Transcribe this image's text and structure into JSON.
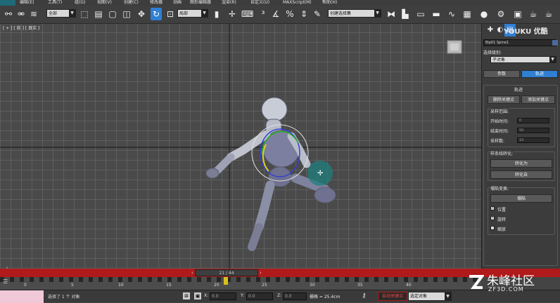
{
  "menu": [
    "编辑(E)",
    "工具(T)",
    "组(G)",
    "视图(V)",
    "创建(C)",
    "修改器",
    "动画",
    "图形编辑器",
    "渲染(R)",
    "自定义(U)",
    "MAXScript(M)",
    "帮助(H)"
  ],
  "toolbar": {
    "filter_value": "全部",
    "refcoord_value": "局部",
    "selection_set_value": "创建选择集",
    "icons": [
      "link-icon",
      "unlink-icon",
      "bind-icon",
      "select-icon",
      "select-by-name-icon",
      "rect-select-icon",
      "window-crossing-icon",
      "move-icon",
      "rotate-icon",
      "scale-icon",
      "pivot-icon",
      "snap-icon",
      "angle-snap-icon",
      "percent-snap-icon",
      "spinner-snap-icon",
      "mirror-icon",
      "align-icon",
      "layer-icon",
      "curve-editor-icon",
      "schematic-icon",
      "material-icon",
      "render-setup-icon",
      "render-frame-icon",
      "render-icon"
    ]
  },
  "viewport": {
    "label": "[ + ] [ 前 ] [ 真实 ]"
  },
  "watermark_logo": "YOUKU 优酷",
  "command_panel": {
    "object_name": "Bip01 Spine1",
    "selection_level_label": "选择级别:",
    "sub_object_label": "子对象",
    "tab_params": "参数",
    "tab_trajectories": "轨迹",
    "rollout_title": "轨迹",
    "delete_key_btn": "删除关键点",
    "add_key_btn": "添加关键点",
    "sample_range_label": "采样范围:",
    "start_time_label": "开始时间:",
    "start_time_value": "0",
    "end_time_label": "结束时间:",
    "end_time_value": "50",
    "samples_label": "采样数:",
    "samples_value": "10",
    "spline_convert_label": "样条线转化:",
    "convert_to_btn": "转化为",
    "convert_from_btn": "转化自",
    "collapse_transform_label": "塌陷变换:",
    "collapse_btn": "塌陷",
    "position_label": "位置",
    "rotation_label": "旋转",
    "scale_label": "缩放",
    "position_checked": true,
    "rotation_checked": true,
    "scale_checked": false
  },
  "timeline": {
    "slider_text": "21 / 44",
    "ticks": [
      "0",
      "5",
      "10",
      "15",
      "20",
      "25",
      "30",
      "35",
      "40"
    ]
  },
  "status": {
    "selection_text": "选择了 1 个 对象",
    "x_label": "X:",
    "x_value": "0.0",
    "y_label": "Y:",
    "y_value": "0.0",
    "z_label": "Z:",
    "z_value": "0.0",
    "grid_text": "栅格 = 25.4cm",
    "auto_key_btn": "自动关键点",
    "selected_object_value": "选定对象"
  },
  "bottom_watermark": {
    "brand": "朱峰社区",
    "site": "ZF3D.COM"
  },
  "colors": {
    "accent": "#2f7fd3",
    "timebar": "#b01a1a",
    "viewport_bg": "#4a4a4a",
    "grid": "#5e5e5e",
    "character": "#8a8fa6"
  }
}
